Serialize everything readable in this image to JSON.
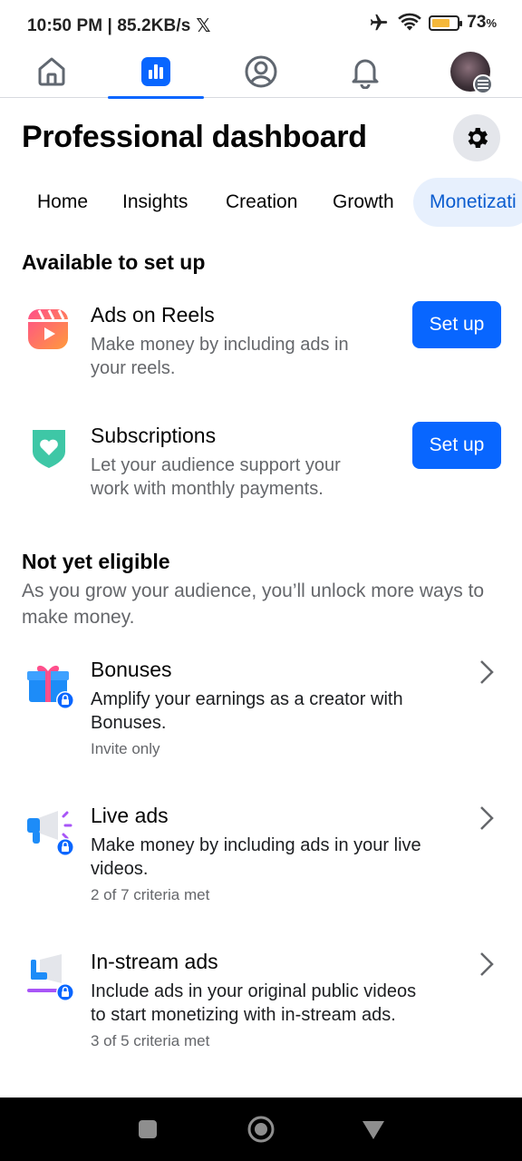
{
  "status_bar": {
    "time_speed": "10:50 PM | 85.2KB/s",
    "x_logo": "𝕏",
    "battery": "73",
    "battery_unit": "%"
  },
  "top_nav": {
    "items": [
      {
        "name": "home-icon"
      },
      {
        "name": "dashboard-icon",
        "active": true
      },
      {
        "name": "profile-icon"
      },
      {
        "name": "bell-icon"
      },
      {
        "name": "avatar"
      }
    ],
    "accent": "#0866ff"
  },
  "header": {
    "title": "Professional dashboard"
  },
  "tabs": [
    {
      "label": "Home"
    },
    {
      "label": "Insights"
    },
    {
      "label": "Creation"
    },
    {
      "label": "Growth"
    },
    {
      "label": "Monetizati",
      "active": true
    }
  ],
  "available": {
    "title": "Available to set up",
    "items": [
      {
        "title": "Ads on Reels",
        "desc_line1": "Make money by including ads in",
        "desc_line2": "your reels.",
        "button": "Set up",
        "icon": "reels-icon"
      },
      {
        "title": "Subscriptions",
        "desc_line1": "Let your audience support your",
        "desc_line2": "work with monthly payments.",
        "button": "Set up",
        "icon": "heart-shield-icon"
      }
    ]
  },
  "not_eligible": {
    "title": "Not yet eligible",
    "sub_line1": "As you grow your audience, you’ll unlock more ways to",
    "sub_line2": "make money.",
    "items": [
      {
        "title": "Bonuses",
        "desc_line1": "Amplify your earnings as a creator with",
        "desc_line2": "Bonuses.",
        "meta": "Invite only",
        "icon": "gift-icon"
      },
      {
        "title": "Live ads",
        "desc_line1": "Make money by including ads in your live",
        "desc_line2": "videos.",
        "meta": "2 of 7 criteria met",
        "icon": "megaphone-icon"
      },
      {
        "title": "In-stream ads",
        "desc_line1": "Include ads in your original public videos",
        "desc_line2": "to start monetizing with in-stream ads.",
        "meta": "3 of 5 criteria met",
        "icon": "instream-icon"
      }
    ]
  },
  "colors": {
    "primary": "#0866ff",
    "tab_active_bg": "#e7f0fd",
    "tab_active_text": "#0a5ccf",
    "secondary_text": "#65676b"
  }
}
